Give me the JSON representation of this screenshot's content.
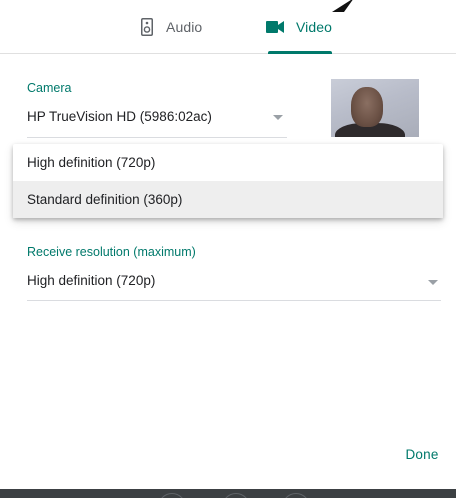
{
  "tabs": [
    {
      "label": "Audio",
      "icon": "speaker-icon",
      "selected": false
    },
    {
      "label": "Video",
      "icon": "video-camera-icon",
      "selected": true
    }
  ],
  "camera": {
    "label": "Camera",
    "value": "HP TrueVision HD (5986:02ac)"
  },
  "send_resolution_menu": {
    "options": [
      {
        "label": "High definition (720p)",
        "highlighted": false
      },
      {
        "label": "Standard definition (360p)",
        "highlighted": true
      }
    ]
  },
  "receive_resolution": {
    "label": "Receive resolution (maximum)",
    "value": "High definition (720p)"
  },
  "done_label": "Done",
  "colors": {
    "accent": "#00796b",
    "text": "#202124",
    "muted": "#5f6368",
    "divider": "#dadce0",
    "highlight": "#eeeeee"
  }
}
